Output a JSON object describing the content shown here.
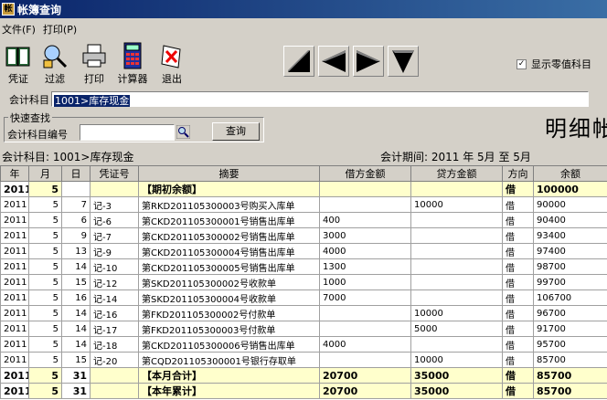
{
  "window": {
    "title": "帐簿查询"
  },
  "menu": [
    "文件(F)",
    "打印(P)"
  ],
  "toolbar": [
    "凭证",
    "过滤",
    "打印",
    "计算器",
    "退出"
  ],
  "show_zero": {
    "label": "显示零值科目",
    "checked": "✓"
  },
  "account": {
    "label": "会计科目",
    "value": "1001>库存现金"
  },
  "quick": {
    "legend": "快速查找",
    "code_label": "会计科目编号",
    "query_button": "查询"
  },
  "ledger_title": "明细帐",
  "info": {
    "account": "会计科目: 1001>库存现金",
    "period": "会计期间: 2011 年 5月 至 5月"
  },
  "columns": [
    "年",
    "月",
    "日",
    "凭证号",
    "摘要",
    "借方金额",
    "贷方金额",
    "方向",
    "余额"
  ],
  "rows": [
    [
      "2011",
      "5",
      "",
      "",
      "【期初余额】",
      "",
      "",
      "借",
      "100000"
    ],
    [
      "2011",
      "5",
      "7",
      "记-3",
      "第RKD201105300003号购买入库单",
      "",
      "10000",
      "借",
      "90000"
    ],
    [
      "2011",
      "5",
      "6",
      "记-6",
      "第CKD201105300001号销售出库单",
      "400",
      "",
      "借",
      "90400"
    ],
    [
      "2011",
      "5",
      "9",
      "记-7",
      "第CKD201105300002号销售出库单",
      "3000",
      "",
      "借",
      "93400"
    ],
    [
      "2011",
      "5",
      "13",
      "记-9",
      "第CKD201105300004号销售出库单",
      "4000",
      "",
      "借",
      "97400"
    ],
    [
      "2011",
      "5",
      "14",
      "记-10",
      "第CKD201105300005号销售出库单",
      "1300",
      "",
      "借",
      "98700"
    ],
    [
      "2011",
      "5",
      "15",
      "记-12",
      "第SKD201105300002号收款单",
      "1000",
      "",
      "借",
      "99700"
    ],
    [
      "2011",
      "5",
      "16",
      "记-14",
      "第SKD201105300004号收款单",
      "7000",
      "",
      "借",
      "106700"
    ],
    [
      "2011",
      "5",
      "14",
      "记-16",
      "第FKD201105300002号付款单",
      "",
      "10000",
      "借",
      "96700"
    ],
    [
      "2011",
      "5",
      "14",
      "记-17",
      "第FKD201105300003号付款单",
      "",
      "5000",
      "借",
      "91700"
    ],
    [
      "2011",
      "5",
      "14",
      "记-18",
      "第CKD201105300006号销售出库单",
      "4000",
      "",
      "借",
      "95700"
    ],
    [
      "2011",
      "5",
      "15",
      "记-20",
      "第CQD201105300001号银行存取单",
      "",
      "10000",
      "借",
      "85700"
    ],
    [
      "2011",
      "5",
      "31",
      "",
      "【本月合计】",
      "20700",
      "35000",
      "借",
      "85700"
    ],
    [
      "2011",
      "5",
      "31",
      "",
      "【本年累计】",
      "20700",
      "35000",
      "借",
      "85700"
    ]
  ]
}
